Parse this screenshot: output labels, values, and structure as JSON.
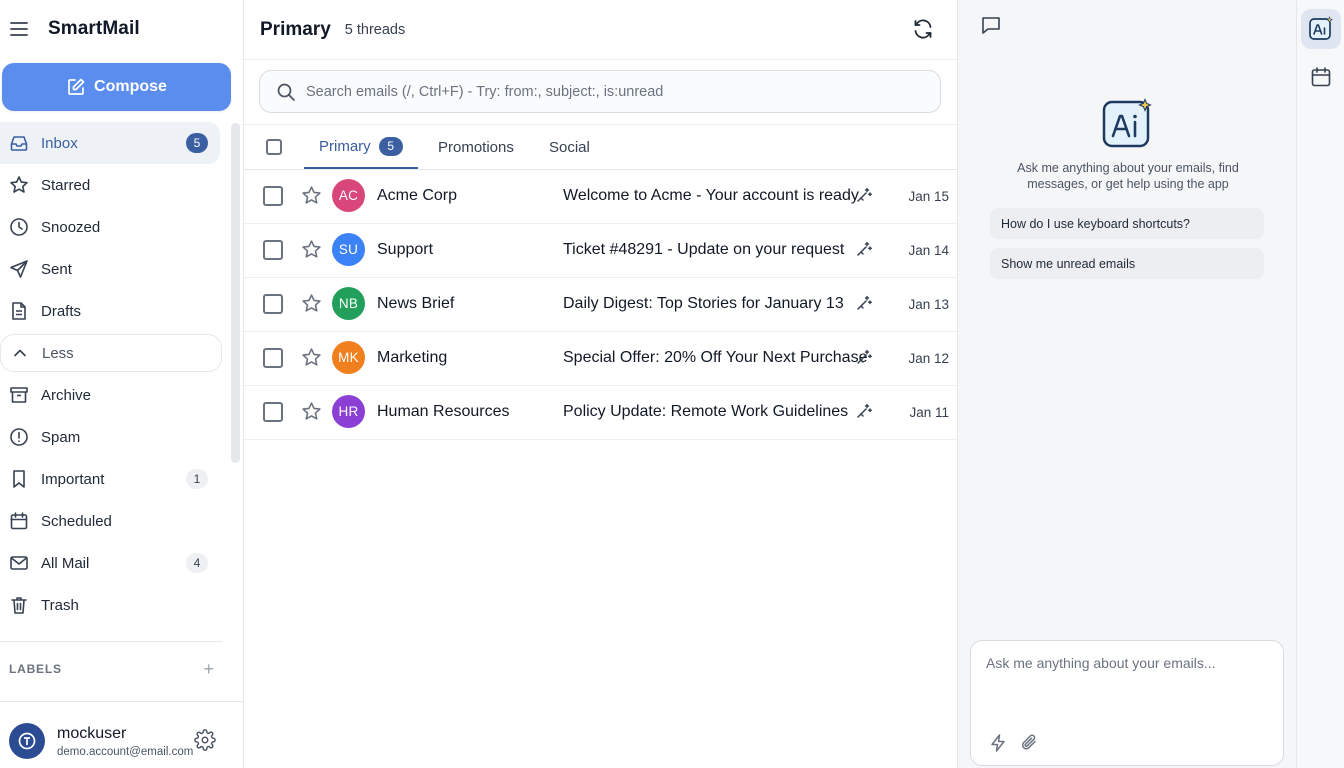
{
  "app": {
    "name": "SmartMail"
  },
  "compose": {
    "label": "Compose"
  },
  "sidebar": {
    "items": [
      {
        "id": "inbox",
        "label": "Inbox",
        "icon": "inbox-icon",
        "count": "5",
        "active": true
      },
      {
        "id": "starred",
        "label": "Starred",
        "icon": "star-icon"
      },
      {
        "id": "snoozed",
        "label": "Snoozed",
        "icon": "clock-icon"
      },
      {
        "id": "sent",
        "label": "Sent",
        "icon": "send-icon"
      },
      {
        "id": "drafts",
        "label": "Drafts",
        "icon": "draft-icon"
      },
      {
        "id": "less",
        "label": "Less",
        "icon": "chevron-up-icon"
      },
      {
        "id": "archive",
        "label": "Archive",
        "icon": "archive-icon"
      },
      {
        "id": "spam",
        "label": "Spam",
        "icon": "alert-icon"
      },
      {
        "id": "important",
        "label": "Important",
        "icon": "bookmark-icon",
        "count": "1"
      },
      {
        "id": "scheduled",
        "label": "Scheduled",
        "icon": "calendar-icon"
      },
      {
        "id": "all-mail",
        "label": "All Mail",
        "icon": "mail-icon",
        "count": "4"
      },
      {
        "id": "trash",
        "label": "Trash",
        "icon": "trash-icon"
      }
    ],
    "labels_heading": "LABELS",
    "add_label": "+"
  },
  "user": {
    "name": "mockuser",
    "email": "demo.account@email.com"
  },
  "main": {
    "title": "Primary",
    "thread_count": "5 threads",
    "search_placeholder": "Search emails (/, Ctrl+F) - Try: from:, subject:, is:unread",
    "tabs": [
      {
        "label": "Primary",
        "badge": "5",
        "active": true
      },
      {
        "label": "Promotions"
      },
      {
        "label": "Social"
      }
    ],
    "emails": [
      {
        "initials": "AC",
        "avatar_color": "#d8467a",
        "sender": "Acme Corp",
        "subject": "Welcome to Acme - Your account is ready",
        "date": "Jan 15"
      },
      {
        "initials": "SU",
        "avatar_color": "#3b82f6",
        "sender": "Support",
        "subject": "Ticket #48291 - Update on your request",
        "date": "Jan 14"
      },
      {
        "initials": "NB",
        "avatar_color": "#22a05b",
        "sender": "News Brief",
        "subject": "Daily Digest: Top Stories for January 13",
        "date": "Jan 13"
      },
      {
        "initials": "MK",
        "avatar_color": "#f07f1d",
        "sender": "Marketing",
        "subject": "Special Offer: 20% Off Your Next Purchase",
        "date": "Jan 12"
      },
      {
        "initials": "HR",
        "avatar_color": "#8b3fd4",
        "sender": "Human Resources",
        "subject": "Policy Update: Remote Work Guidelines",
        "date": "Jan 11"
      }
    ]
  },
  "assistant": {
    "intro": "Ask me anything about your emails, find messages, or get help using the app",
    "suggestions": [
      "How do I use keyboard shortcuts?",
      "Show me unread emails"
    ],
    "input_placeholder": "Ask me anything about your emails..."
  },
  "colors": {
    "accent": "#3b5fa0",
    "compose": "#5b8def"
  }
}
